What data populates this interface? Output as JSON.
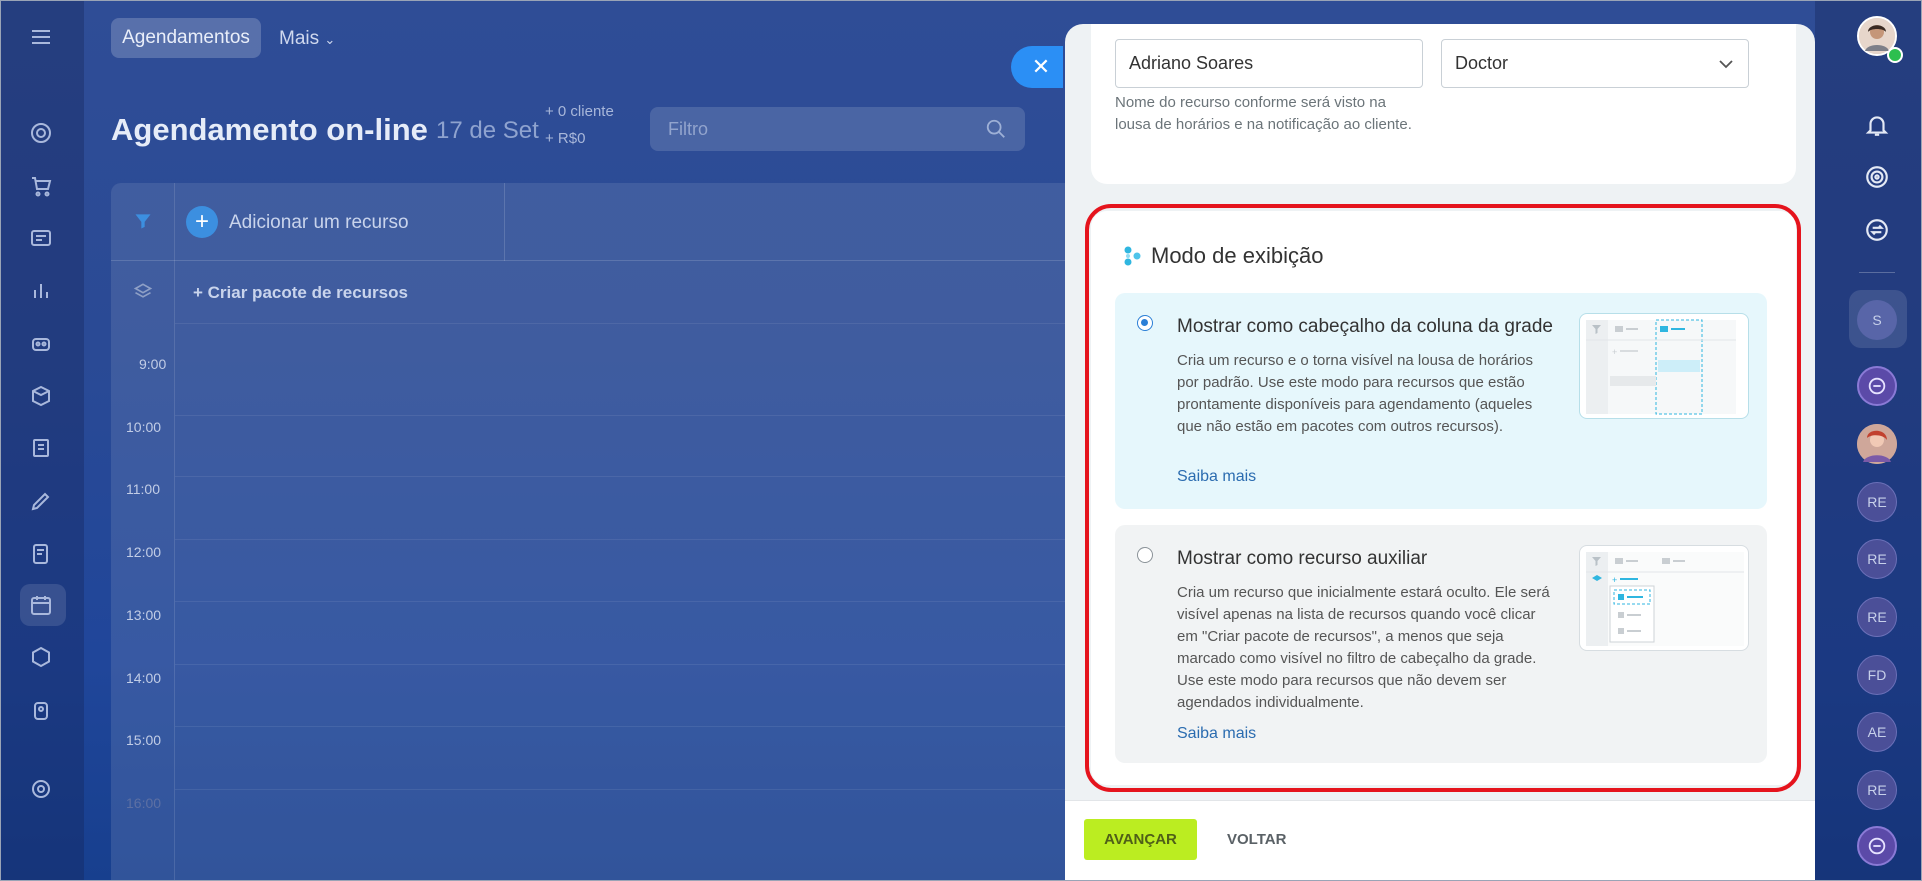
{
  "topnav": {
    "active_tab": "Agendamentos",
    "more_label": "Mais"
  },
  "header": {
    "title": "Agendamento on-line",
    "date": "17 de Set",
    "stat_clients": "+ 0 cliente",
    "stat_revenue": "+ R$0",
    "filter_placeholder": "Filtro"
  },
  "grid": {
    "add_resource": "Adicionar um recurso",
    "create_package": "+ Criar pacote de recursos",
    "times": [
      "9:00",
      "10:00",
      "11:00",
      "12:00",
      "13:00",
      "14:00",
      "15:00",
      "16:00"
    ]
  },
  "panel": {
    "name_value": "Adriano Soares",
    "type_value": "Doctor",
    "name_hint": "Nome do recurso conforme será visto na lousa de horários e na notificação ao cliente.",
    "section_title": "Modo de exibição",
    "option1": {
      "title": "Mostrar como cabeçalho da coluna da grade",
      "desc": "Cria um recurso e o torna visível na lousa de horários por padrão. Use este modo para recursos que estão prontamente disponíveis para agendamento (aqueles que não estão em pacotes com outros recursos).",
      "link": "Saiba mais",
      "selected": true
    },
    "option2": {
      "title": "Mostrar como recurso auxiliar",
      "desc": "Cria um recurso que inicialmente estará oculto. Ele será visível apenas na lista de recursos quando você clicar em \"Criar pacote de recursos\", a menos que seja marcado como visível no filtro de cabeçalho da grade. Use este modo para recursos que não devem ser agendados individualmente.",
      "link": "Saiba mais",
      "selected": false
    },
    "next_button": "AVANÇAR",
    "back_button": "VOLTAR"
  },
  "rightbar": {
    "avatars": [
      "S",
      "RE",
      "RE",
      "RE",
      "FD",
      "AE",
      "RE"
    ]
  },
  "colors": {
    "accent_blue": "#2b8ff5",
    "next_green": "#bbed21",
    "highlight_red": "#e5141d"
  }
}
